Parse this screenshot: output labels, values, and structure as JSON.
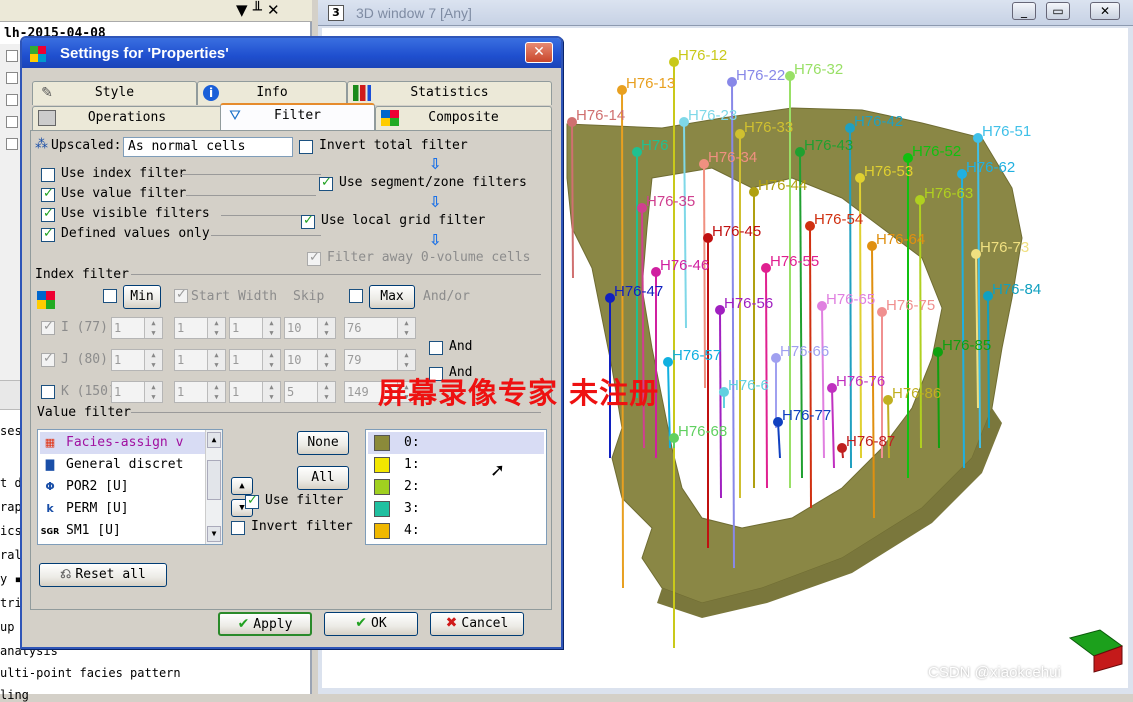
{
  "left_pane": {
    "tree_title": "lh-2015-04-08",
    "ctl_pin": "▼ ╨ ✕",
    "cut_items": [
      "t d",
      "rap",
      "ics",
      "ral",
      "y ▪",
      "tri",
      "up",
      "analysis",
      "ulti-point facies pattern",
      "ses",
      "ling"
    ]
  },
  "view3d": {
    "num": "3",
    "title": "3D window 7 [Any]",
    "btn_min": "_",
    "btn_max": "▭",
    "btn_close": "✕",
    "well_labels": [
      {
        "t": "H76-12",
        "c": "#c9c91a"
      },
      {
        "t": "H76-13",
        "c": "#e8a020"
      },
      {
        "t": "H76-22",
        "c": "#8888e8"
      },
      {
        "t": "H76-32",
        "c": "#99e066"
      },
      {
        "t": "H76-14",
        "c": "#d07070"
      },
      {
        "t": "H76-23",
        "c": "#7fd8e8"
      },
      {
        "t": "H76-33",
        "c": "#d0c030"
      },
      {
        "t": "H76-42",
        "c": "#20a0c0"
      },
      {
        "t": "H76-51",
        "c": "#40c0e8"
      },
      {
        "t": "H76",
        "c": "#20c090"
      },
      {
        "t": "H76-34",
        "c": "#f09080"
      },
      {
        "t": "H76-43",
        "c": "#20a030"
      },
      {
        "t": "H76-52",
        "c": "#10c010"
      },
      {
        "t": "H76-53",
        "c": "#e0d030"
      },
      {
        "t": "H76-62",
        "c": "#20b0e0"
      },
      {
        "t": "H76-44",
        "c": "#b0a010"
      },
      {
        "t": "H76-63",
        "c": "#b0d020"
      },
      {
        "t": "H76-35",
        "c": "#d04090"
      },
      {
        "t": "H76-45",
        "c": "#c01010"
      },
      {
        "t": "H76-54",
        "c": "#d03010"
      },
      {
        "t": "H76-64",
        "c": "#e09010"
      },
      {
        "t": "H76-46",
        "c": "#d020a0"
      },
      {
        "t": "H76-55",
        "c": "#e02090"
      },
      {
        "t": "H76-73",
        "c": "#f0e080"
      },
      {
        "t": "H76-47",
        "c": "#1020c0"
      },
      {
        "t": "H76-56",
        "c": "#a020c0"
      },
      {
        "t": "H76-65",
        "c": "#e080e0"
      },
      {
        "t": "H76-75",
        "c": "#f09090"
      },
      {
        "t": "H76-84",
        "c": "#10a0c0"
      },
      {
        "t": "H76-57",
        "c": "#10b0e0"
      },
      {
        "t": "H76-66",
        "c": "#a0a0f0"
      },
      {
        "t": "H76-85",
        "c": "#10a010"
      },
      {
        "t": "H76-76",
        "c": "#c030c0"
      },
      {
        "t": "H76-6",
        "c": "#60d0e0"
      },
      {
        "t": "H76-86",
        "c": "#c0b020"
      },
      {
        "t": "H76-77",
        "c": "#1040c0"
      },
      {
        "t": "H76-68",
        "c": "#60d060"
      },
      {
        "t": "H76-87",
        "c": "#c02020"
      }
    ],
    "watermark": "CSDN @xiaokcehui"
  },
  "dialog": {
    "title": "Settings for 'Properties'",
    "close": "✕",
    "tabs_row1": [
      "Style",
      "Info",
      "Statistics"
    ],
    "tabs_row2": [
      "Operations",
      "Filter",
      "Composite"
    ],
    "upscaled_label": "Upscaled:",
    "upscaled_value": "As normal cells",
    "invert_total": "Invert total filter",
    "use_index": "Use index filter",
    "use_value": "Use value filter",
    "use_visible": "Use visible filters",
    "defined_only": "Defined values only",
    "use_segment": "Use segment/zone filters",
    "use_local": "Use local grid filter",
    "filter_away": "Filter away 0-volume cells",
    "index_filter": "Index filter",
    "min": "Min",
    "start_width": "Start Width",
    "skip": "Skip",
    "max": "Max",
    "andor": "And/or",
    "rows": [
      {
        "label": "I (77)",
        "a": "1",
        "b": "1",
        "c": "1",
        "d": "10",
        "e": "76",
        "and": "And"
      },
      {
        "label": "J (80)",
        "a": "1",
        "b": "1",
        "c": "1",
        "d": "10",
        "e": "79",
        "and": "And"
      },
      {
        "label": "K (150)",
        "a": "1",
        "b": "1",
        "c": "1",
        "d": "5",
        "e": "149",
        "and": ""
      }
    ],
    "and_label": "And",
    "value_filter": "Value filter",
    "properties": [
      {
        "icon": "▦",
        "name": "Facies-assign v"
      },
      {
        "icon": "▇",
        "name": "General discret"
      },
      {
        "icon": "Φ",
        "name": "POR2 [U]"
      },
      {
        "icon": "k",
        "name": "PERM [U]"
      },
      {
        "icon": "SGR",
        "name": "SM1 [U]"
      }
    ],
    "none_btn": "None",
    "all_btn": "All",
    "use_filter": "Use filter",
    "invert_filter": "Invert filter",
    "values": [
      {
        "label": "0:",
        "color": "#8b8a3a"
      },
      {
        "label": "1:",
        "color": "#f2e600"
      },
      {
        "label": "2:",
        "color": "#a0d020"
      },
      {
        "label": "3:",
        "color": "#20c0a0"
      },
      {
        "label": "4:",
        "color": "#f0b800"
      }
    ],
    "reset_all": "Reset all",
    "apply": "Apply",
    "ok": "OK",
    "cancel": "Cancel"
  },
  "overlay_red": "屏幕录像专家 未注册",
  "colors": {
    "surface": "#8a8745",
    "dialog_border": "#2f55b8"
  }
}
